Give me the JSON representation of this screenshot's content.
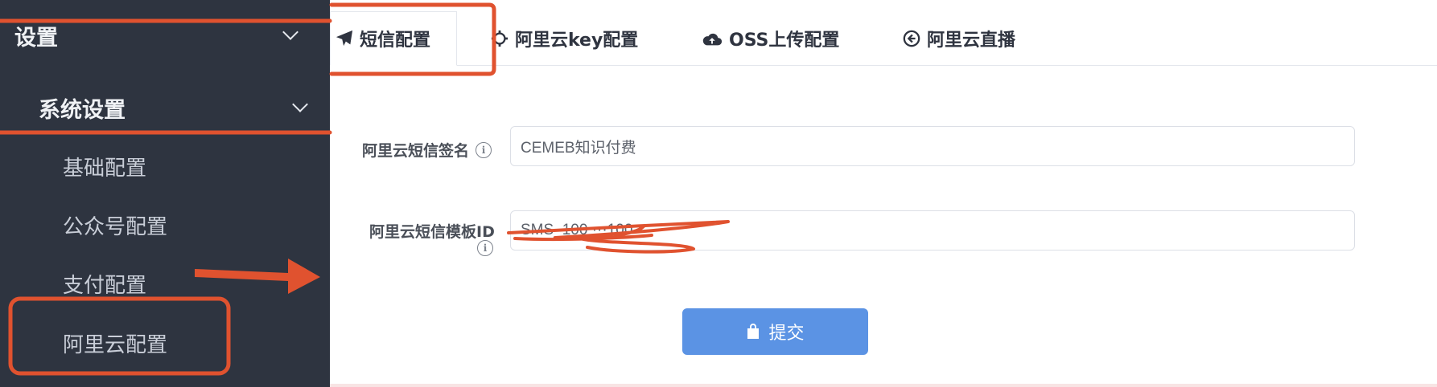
{
  "sidebar": {
    "top_label": "设置",
    "sub_label": "系统设置",
    "children": [
      "基础配置",
      "公众号配置",
      "支付配置",
      "阿里云配置"
    ]
  },
  "tabs": [
    {
      "label": "短信配置",
      "icon": "paper-plane-icon",
      "active": true
    },
    {
      "label": "阿里云key配置",
      "icon": "gear-icon",
      "active": false
    },
    {
      "label": "OSS上传配置",
      "icon": "cloud-upload-icon",
      "active": false
    },
    {
      "label": "阿里云直播",
      "icon": "circle-arrow-left-icon",
      "active": false
    }
  ],
  "form": {
    "sms_sign_label": "阿里云短信签名",
    "sms_sign_value": "CEMEB知识付费",
    "sms_template_label": "阿里云短信模板ID",
    "sms_template_value": "SMS_100 ···100",
    "info_glyph": "i",
    "submit_label": "提交",
    "submit_icon": "bag-icon"
  },
  "colors": {
    "sidebar_bg": "#2e3440",
    "accent": "#5b93e4",
    "annotation": "#e0522f"
  }
}
